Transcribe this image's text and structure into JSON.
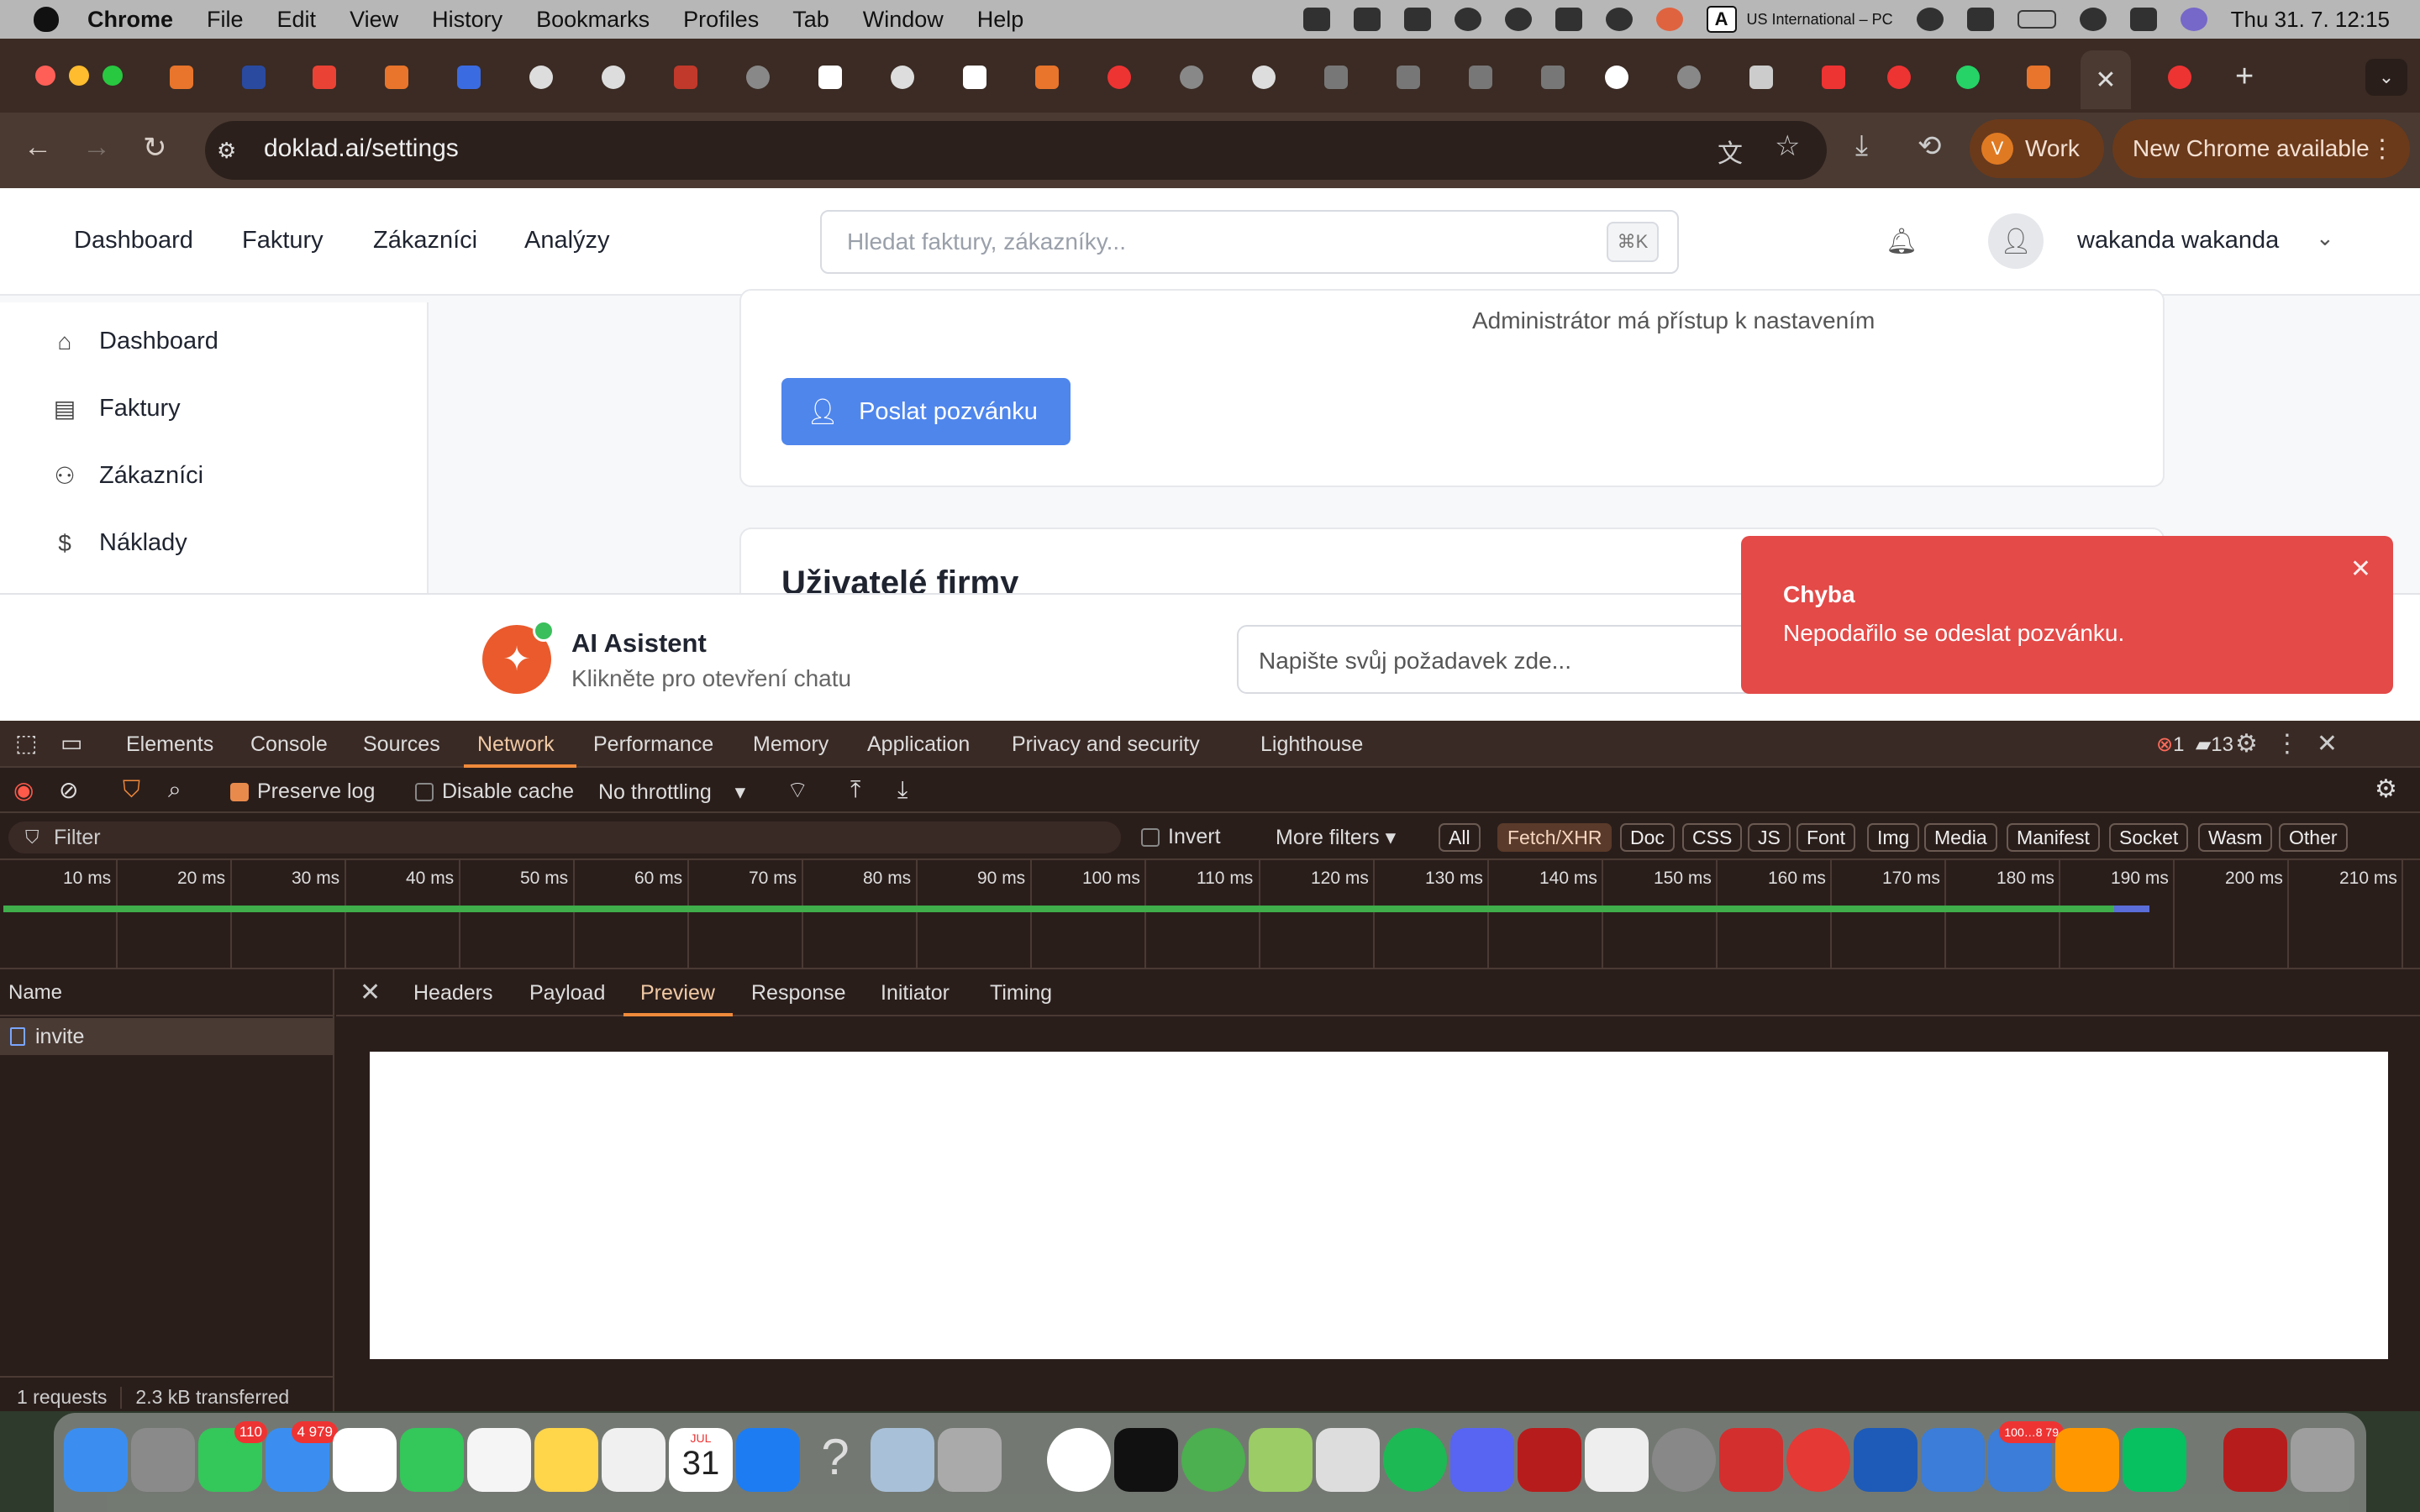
{
  "menubar": {
    "app": "Chrome",
    "items": [
      "File",
      "Edit",
      "View",
      "History",
      "Bookmarks",
      "Profiles",
      "Tab",
      "Window",
      "Help"
    ],
    "keyboard_badge": "A",
    "keyboard_layout": "US International – PC",
    "datetime": "Thu 31. 7.  12:15"
  },
  "chrome": {
    "url": "doklad.ai/settings",
    "profile_initial": "V",
    "profile_label": "Work",
    "update_label": "New Chrome available",
    "tab_close": "✕",
    "new_tab": "+"
  },
  "app": {
    "nav": [
      "Dashboard",
      "Faktury",
      "Zákazníci",
      "Analýzy"
    ],
    "search_placeholder": "Hledat faktury, zákazníky...",
    "search_shortcut": "⌘K",
    "user_name": "wakanda wakanda",
    "sidebar": [
      "Dashboard",
      "Faktury",
      "Zákazníci",
      "Náklady"
    ],
    "admin_info": "Administrátor má přístup k nastavením",
    "invite_button": "Poslat pozvánku",
    "users_section_title": "Uživatelé firmy"
  },
  "ai_assistant": {
    "title": "AI Asistent",
    "subtitle": "Klikněte pro otevření chatu",
    "input_placeholder": "Napište svůj požadavek zde..."
  },
  "toast": {
    "title": "Chyba",
    "message": "Nepodařilo se odeslat pozvánku.",
    "color": "#e34a48"
  },
  "devtools": {
    "tabs": [
      "Elements",
      "Console",
      "Sources",
      "Network",
      "Performance",
      "Memory",
      "Application",
      "Privacy and security",
      "Lighthouse"
    ],
    "active_tab": "Network",
    "error_count": "1",
    "message_count": "13",
    "preserve_log": "Preserve log",
    "disable_cache": "Disable cache",
    "throttling": "No throttling",
    "filter_placeholder": "Filter",
    "invert": "Invert",
    "more_filters": "More filters",
    "type_filters": [
      "All",
      "Fetch/XHR",
      "Doc",
      "CSS",
      "JS",
      "Font",
      "Img",
      "Media",
      "Manifest",
      "Socket",
      "Wasm",
      "Other"
    ],
    "active_type_filter": "Fetch/XHR",
    "timeline_ticks": [
      "10 ms",
      "20 ms",
      "30 ms",
      "40 ms",
      "50 ms",
      "60 ms",
      "70 ms",
      "80 ms",
      "90 ms",
      "100 ms",
      "110 ms",
      "120 ms",
      "130 ms",
      "140 ms",
      "150 ms",
      "160 ms",
      "170 ms",
      "180 ms",
      "190 ms",
      "200 ms",
      "210 ms"
    ],
    "name_header": "Name",
    "requests": [
      {
        "name": "invite"
      }
    ],
    "detail_tabs": [
      "Headers",
      "Payload",
      "Preview",
      "Response",
      "Initiator",
      "Timing"
    ],
    "active_detail_tab": "Preview",
    "status_requests": "1 requests",
    "status_transferred": "2.3 kB transferred"
  },
  "dock": {
    "badges": {
      "messages": "110",
      "mail": "4 979",
      "calendar_day": "31",
      "calendar_month": "JUL",
      "filezilla_count": "100…8 79"
    }
  }
}
